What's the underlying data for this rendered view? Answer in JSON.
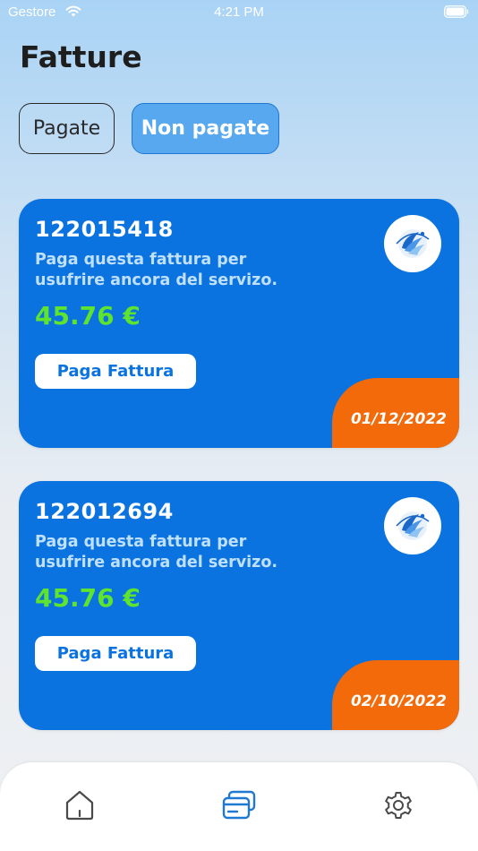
{
  "status_bar": {
    "carrier": "Gestore",
    "time": "4:21 PM",
    "icons": [
      "wifi-icon",
      "battery-icon"
    ]
  },
  "page": {
    "title": "Fatture"
  },
  "tabs": [
    {
      "label": "Pagate",
      "selected": false
    },
    {
      "label": "Non pagate",
      "selected": true
    }
  ],
  "invoices": [
    {
      "number": "122015418",
      "message": "Paga questa fattura per usufrire ancora del servizo.",
      "amount": "45.76 €",
      "button_label": "Paga Fattura",
      "date": "01/12/2022",
      "logo_icon": "company-logo-icon"
    },
    {
      "number": "122012694",
      "message": "Paga questa fattura per usufrire ancora del servizo.",
      "amount": "45.76 €",
      "button_label": "Paga Fattura",
      "date": "02/10/2022",
      "logo_icon": "company-logo-icon"
    }
  ],
  "bottom_nav": {
    "items": [
      {
        "icon": "home-icon",
        "active": false
      },
      {
        "icon": "bills-icon",
        "active": true
      },
      {
        "icon": "settings-icon",
        "active": false
      }
    ]
  },
  "colors": {
    "card_background": "#0a73e0",
    "amount_green": "#5ee32f",
    "date_orange": "#f26a09",
    "tab_selected": "#58a8ef",
    "nav_active": "#1f78d1",
    "nav_inactive": "#4a4a4a"
  }
}
